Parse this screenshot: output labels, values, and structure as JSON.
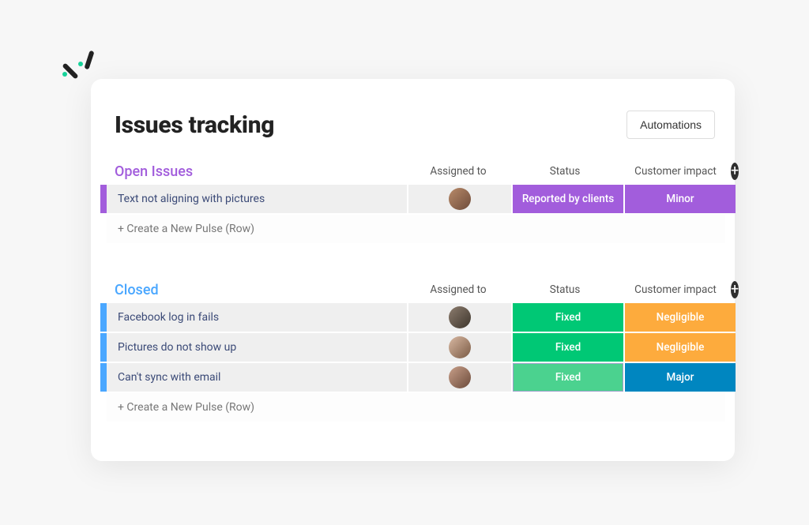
{
  "header": {
    "title": "Issues tracking",
    "automations_label": "Automations"
  },
  "columns": {
    "assigned": "Assigned to",
    "status": "Status",
    "impact": "Customer impact"
  },
  "new_pulse_label": "+ Create a New Pulse (Row)",
  "groups": {
    "open": {
      "title": "Open Issues",
      "color": "#a25ddc",
      "rows": [
        {
          "name": "Text not aligning with pictures",
          "avatar_gradient": "linear-gradient(135deg,#b98b6a,#6e4b3a)",
          "status": {
            "label": "Reported by clients",
            "color": "purple"
          },
          "impact": {
            "label": "Minor",
            "color": "purple"
          }
        }
      ]
    },
    "closed": {
      "title": "Closed",
      "color": "#4aa7ff",
      "rows": [
        {
          "name": "Facebook log in fails",
          "avatar_gradient": "linear-gradient(135deg,#8d7d6f,#3d352c)",
          "status": {
            "label": "Fixed",
            "color": "green"
          },
          "impact": {
            "label": "Negligible",
            "color": "yellow"
          }
        },
        {
          "name": "Pictures do not show up",
          "avatar_gradient": "linear-gradient(135deg,#d9b9a3,#7a5a44)",
          "status": {
            "label": "Fixed",
            "color": "green"
          },
          "impact": {
            "label": "Negligible",
            "color": "yellow"
          }
        },
        {
          "name": "Can't sync with email",
          "avatar_gradient": "linear-gradient(135deg,#c9a08a,#6b4a3a)",
          "status": {
            "label": "Fixed",
            "color": "green-light"
          },
          "impact": {
            "label": "Major",
            "color": "blue"
          }
        }
      ]
    }
  }
}
